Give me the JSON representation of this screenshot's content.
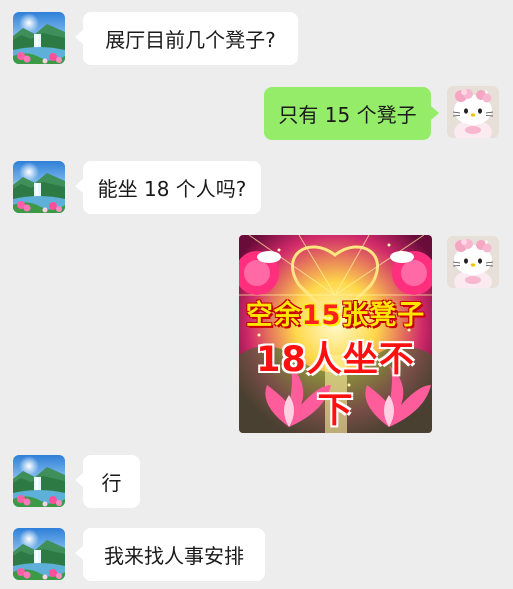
{
  "messages": [
    {
      "side": "left",
      "text": "展厅目前几个凳子?"
    },
    {
      "side": "right",
      "text": "只有 15 个凳子"
    },
    {
      "side": "left",
      "text": "能坐 18 个人吗?"
    },
    {
      "side": "right",
      "type": "sticker",
      "line1_a": "空余",
      "line1_num": "15",
      "line1_b": "张凳子",
      "line2": "18人坐不下"
    },
    {
      "side": "left",
      "text": "行"
    },
    {
      "side": "left",
      "text": "我来找人事安排"
    }
  ],
  "colors": {
    "background": "#ededed",
    "incoming_bubble": "#ffffff",
    "outgoing_bubble": "#95ec69"
  },
  "avatars": {
    "contact": "landscape-waterfall-avatar",
    "self": "hello-kitty-avatar"
  }
}
